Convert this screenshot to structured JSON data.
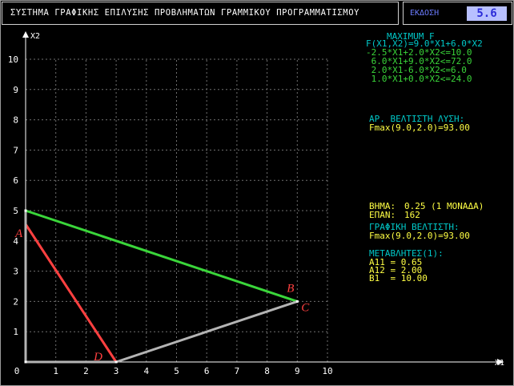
{
  "window": {
    "title": "ΣΥΣΤΗΜΑ ΓΡΑΦΙΚΗΣ ΕΠΙΛΥΣΗΣ ΠΡΟΒΛΗΜΑΤΩΝ ΓΡΑΜΜΙΚΟΥ ΠΡΟΓΡΑΜΜΑΤΙΣΜΟΥ",
    "version_label": "ΕΚΔΟΣΗ",
    "version_value": "5.6"
  },
  "colors": {
    "cyan": "#00c8c8",
    "green": "#3ad63a",
    "yellow": "#ffff44",
    "red": "#ff4040",
    "gray": "#b4b4b4",
    "white": "#ffffff",
    "grid": "#707070"
  },
  "problem": {
    "heading": "MAXIMUM F",
    "objective": "F(X1,X2)=9.0*X1+6.0*X2",
    "constraints": [
      "-2.5*X1+2.0*X2<=10.0",
      " 6.0*X1+9.0*X2<=72.0",
      " 2.0*X1-6.0*X2<=6.0",
      " 1.0*X1+0.0*X2<=24.0"
    ]
  },
  "solution": {
    "label": "ΑΡ. ΒΕΛΤΙΣΤΗ ΛΥΣΗ:",
    "value": "Fmax(9.0,2.0)=93.00"
  },
  "sensitivity": {
    "step_label": "ΒΗΜΑ:",
    "step_value": "0.25 (1 ΜΟΝΑΔΑ)",
    "iter_label": "ΕΠΑΝ:",
    "iter_value": "162",
    "graph_label": "ΓΡΑΦΙΚΗ ΒΕΛΤΙΣΤΗ:",
    "graph_value": "Fmax(9.0,2.0)=93.00",
    "coef_label": "ΜΕΤΑΒΛΗΤΕΣ(1):",
    "coefs": [
      "A11 = 0.65",
      "A12 = 2.00",
      "B1  = 10.00"
    ]
  },
  "chart_data": {
    "type": "line",
    "xlabel": "X1",
    "ylabel": "X2",
    "xlim": [
      0,
      10
    ],
    "ylim": [
      0,
      10
    ],
    "grid": true,
    "x_ticks": [
      1,
      2,
      3,
      4,
      5,
      6,
      7,
      8,
      9,
      10
    ],
    "y_ticks": [
      1,
      2,
      3,
      4,
      5,
      6,
      7,
      8,
      9,
      10
    ],
    "origin_label": "0",
    "series": [
      {
        "color": "green",
        "points": [
          [
            0,
            5
          ],
          [
            9,
            2
          ]
        ]
      },
      {
        "color": "gray",
        "points": [
          [
            3,
            0
          ],
          [
            9,
            2
          ]
        ]
      },
      {
        "color": "red",
        "points": [
          [
            0,
            4.55
          ],
          [
            3,
            0
          ]
        ]
      },
      {
        "color": "gray",
        "points": [
          [
            0,
            0
          ],
          [
            3,
            0
          ]
        ]
      },
      {
        "color": "gray",
        "points": [
          [
            0,
            0
          ],
          [
            0,
            5
          ]
        ]
      }
    ],
    "points": [
      {
        "label": "A",
        "x": 0,
        "y": 4.5
      },
      {
        "label": "B",
        "x": 9,
        "y": 2
      },
      {
        "label": "C",
        "x": 9,
        "y": 2
      },
      {
        "label": "D",
        "x": 3,
        "y": 0
      }
    ]
  }
}
